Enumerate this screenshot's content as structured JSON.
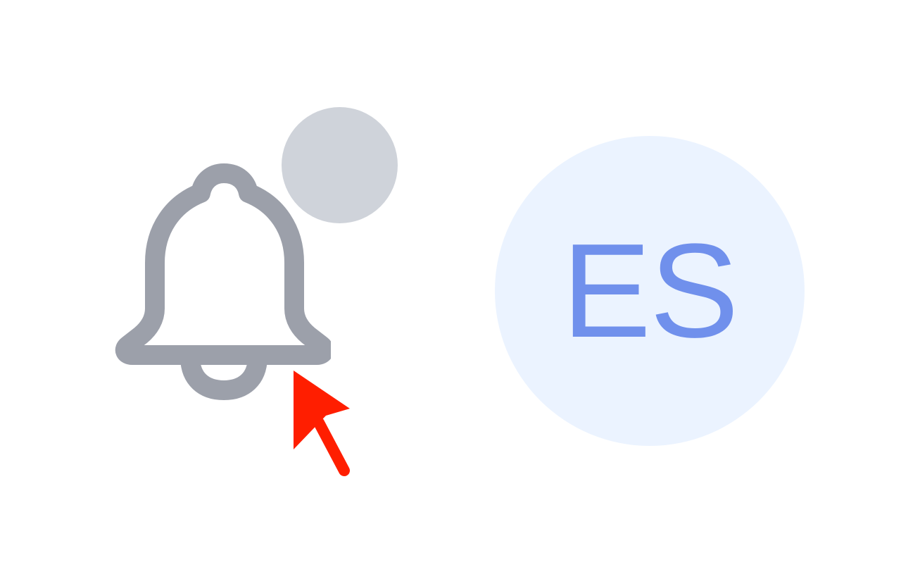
{
  "header": {
    "notifications": {
      "icon": "bell-icon",
      "icon_color": "#9CA0AA",
      "dot_color": "#CFD3DA"
    },
    "user": {
      "initials": "ES",
      "avatar_bg": "#EBF3FF",
      "initials_color": "#7090EC"
    }
  },
  "cursor": {
    "icon": "mouse-pointer-arrow",
    "color": "#FF1E00"
  }
}
